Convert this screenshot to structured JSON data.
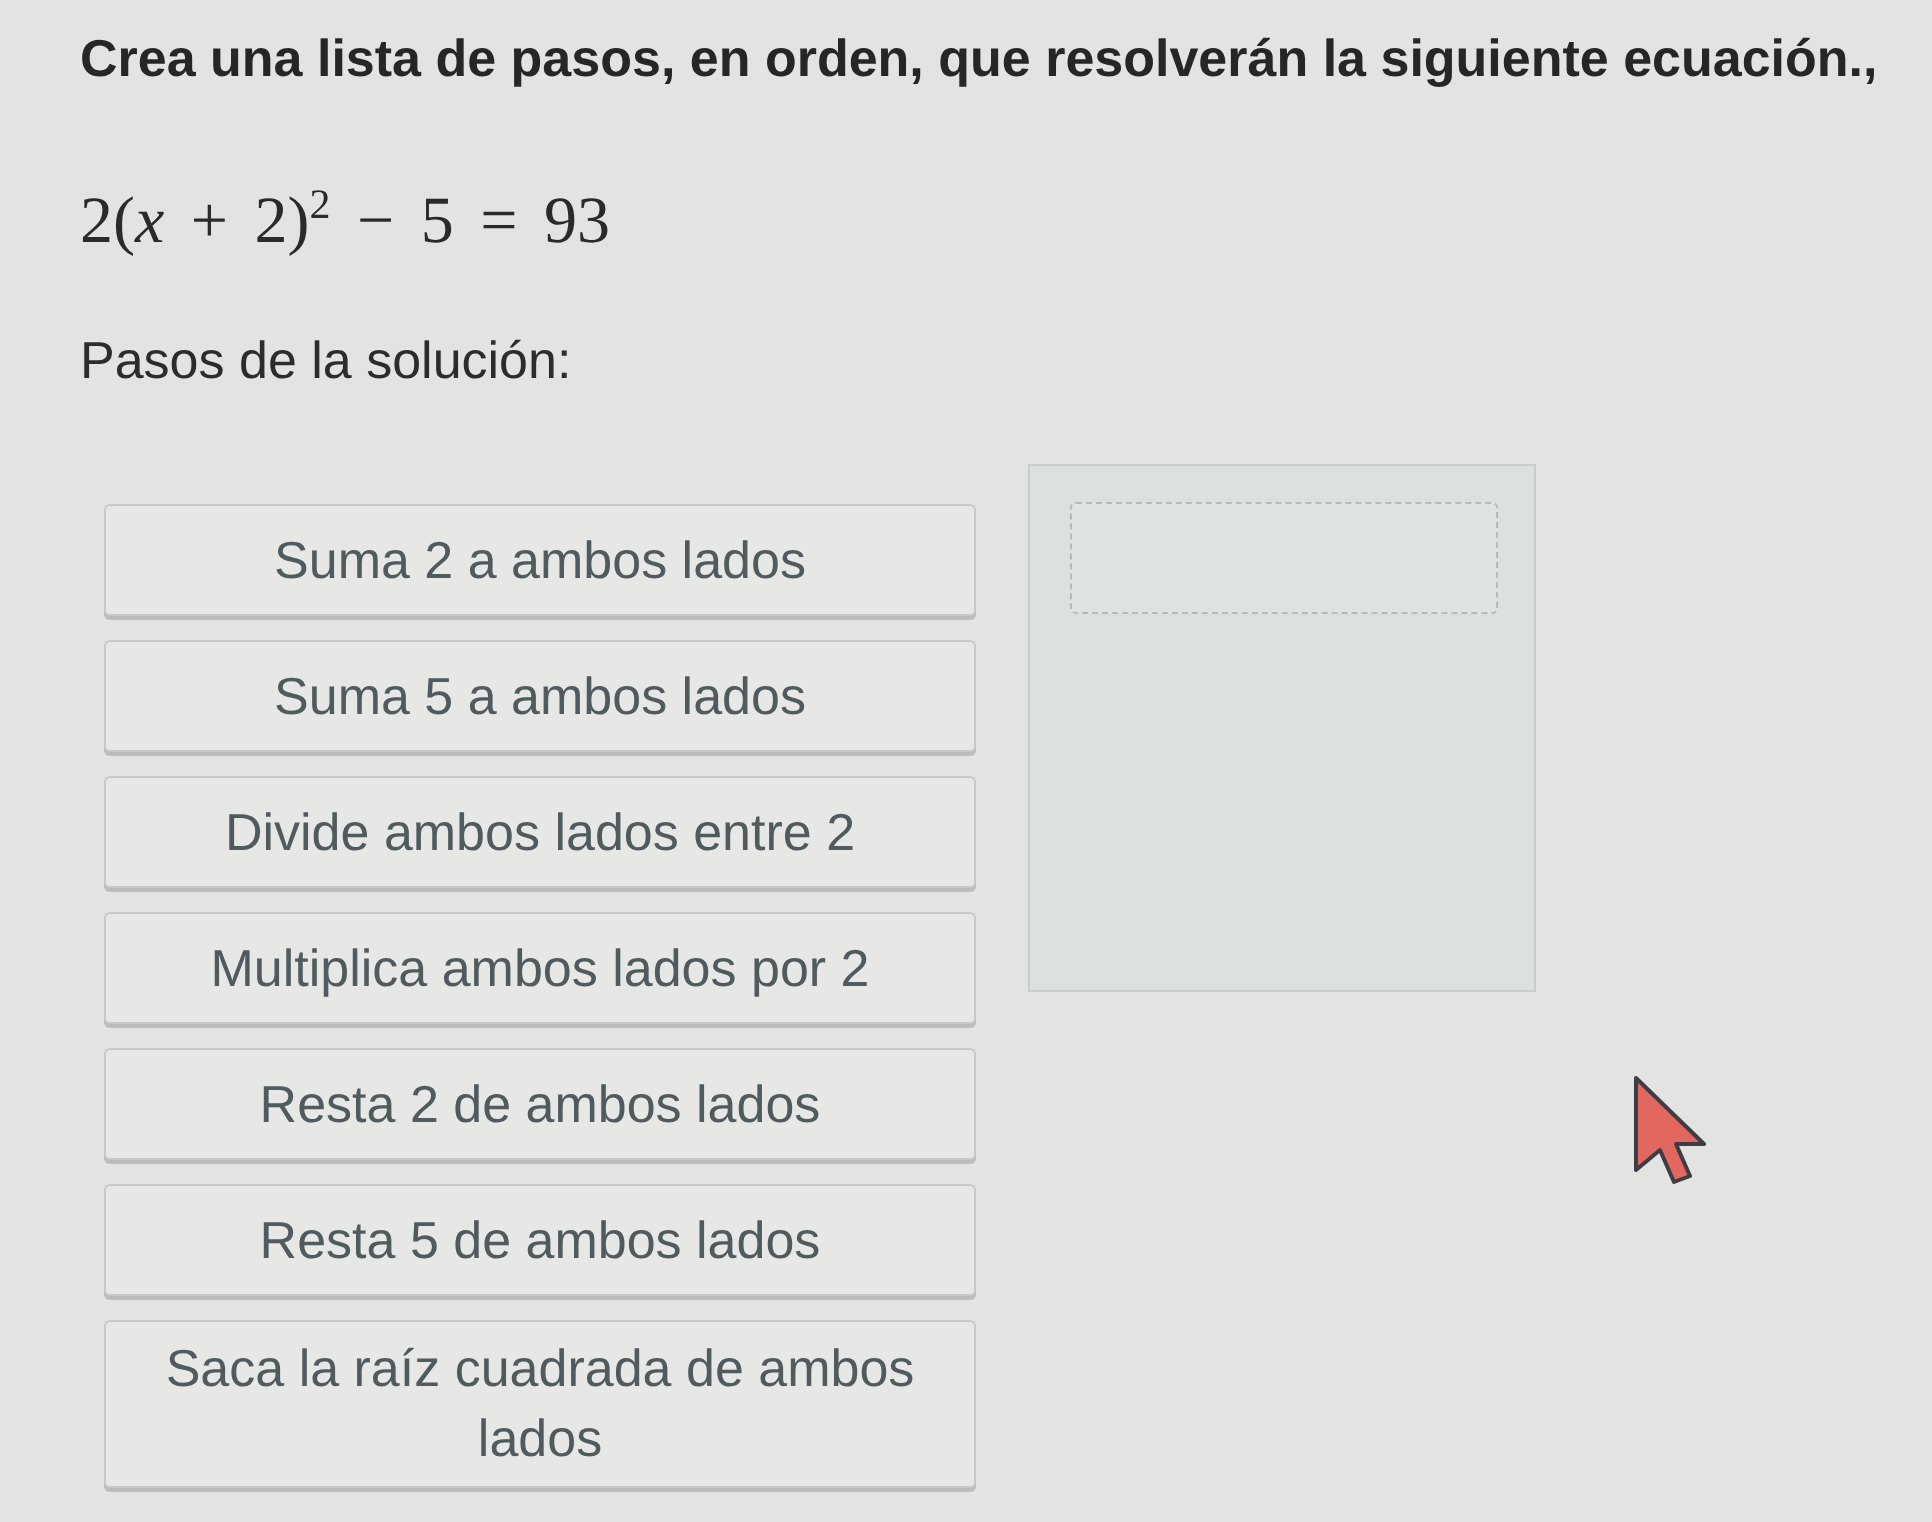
{
  "prompt": "Crea una lista de pasos, en orden, que resolverán la siguiente ecuación.,",
  "equation": "2(*x* + 2)$^{2}$ − 5 = 93",
  "steps_label": "Pasos de la solución:",
  "steps": [
    "Suma 2 a ambos lados",
    "Suma 5 a ambos lados",
    "Divide ambos lados entre 2",
    "Multiplica ambos lados por 2",
    "Resta 2 de ambos lados",
    "Resta 5 de ambos lados",
    "Saca la raíz cuadrada de ambos lados"
  ]
}
